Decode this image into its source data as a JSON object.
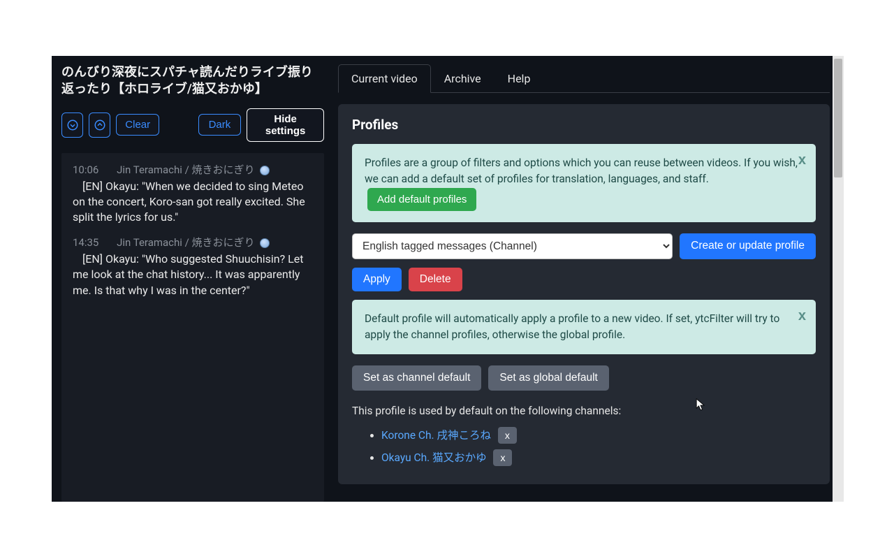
{
  "left": {
    "title": "のんびり深夜にスパチャ読んだりライブ振り返ったり【ホロライブ/猫又おかゆ】",
    "clear": "Clear",
    "dark": "Dark",
    "hide": "Hide settings"
  },
  "messages": [
    {
      "time": "10:06",
      "author": "Jin Teramachi / 焼きおにぎり",
      "body": "[EN] Okayu: \"When we decided to sing Meteo on the concert, Koro-san got really excited. She split the lyrics for us.\""
    },
    {
      "time": "14:35",
      "author": "Jin Teramachi / 焼きおにぎり",
      "body": "[EN] Okayu: \"Who suggested Shuuchisin? Let me look at the chat history... It was apparently me. Is that why I was in the center?\""
    }
  ],
  "tabs": {
    "current": "Current video",
    "archive": "Archive",
    "help": "Help"
  },
  "profiles": {
    "heading": "Profiles",
    "intro_text": "Profiles are a group of filters and options which you can reuse between videos. If you wish, we can add a default set of profiles for translation, languages, and staff.",
    "add_default": "Add default profiles",
    "intro_close": "x",
    "select_value": "English tagged messages (Channel)",
    "create": "Create or update profile",
    "apply": "Apply",
    "delete": "Delete",
    "default_info": "Default profile will automatically apply a profile to a new video. If set, ytcFilter will try to apply the channel profiles, otherwise the global profile.",
    "default_close": "x",
    "set_channel": "Set as channel default",
    "set_global": "Set as global default",
    "used_text": "This profile is used by default on the following channels:",
    "channels": [
      {
        "name": "Korone Ch. 戌神ころね",
        "remove": "x"
      },
      {
        "name": "Okayu Ch. 猫又おかゆ",
        "remove": "x"
      }
    ]
  }
}
